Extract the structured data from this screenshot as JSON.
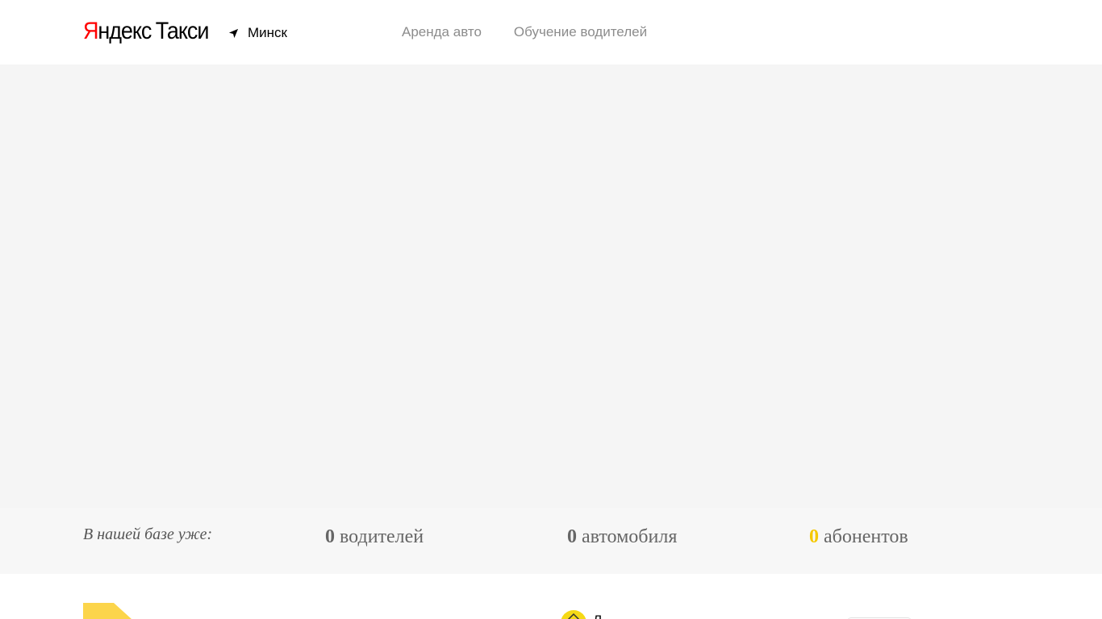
{
  "header": {
    "logo": {
      "brand": "Яндекс",
      "product": "Такси"
    },
    "city": {
      "label": "Минск",
      "icon": "location-arrow-icon"
    },
    "nav": [
      {
        "label": "Аренда авто"
      },
      {
        "label": "Обучение водителей"
      }
    ]
  },
  "stats": {
    "intro": "В нашей базе уже:",
    "items": [
      {
        "value": "0",
        "label": "водителей"
      },
      {
        "value": "0",
        "label": "автомобиля"
      },
      {
        "value": "0",
        "label": "абонентов",
        "highlight": "#f5c800"
      }
    ]
  },
  "bottom": {
    "partial_letter": "Л"
  },
  "colors": {
    "brand_red": "#ff0000",
    "accent_yellow": "#f5c800",
    "hero_bg": "#f5f5f5",
    "nav_text": "#8c8c8c"
  }
}
